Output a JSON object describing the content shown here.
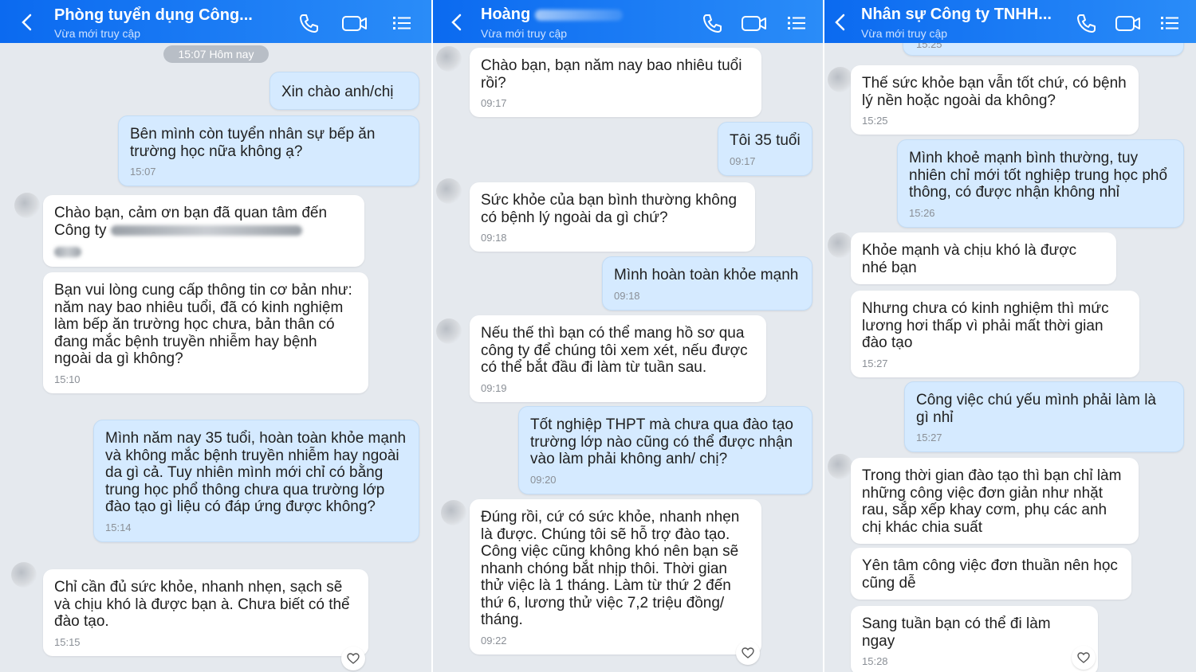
{
  "colors": {
    "header": "#0b6af0",
    "background": "#e5e9ee",
    "incoming": "#ffffff",
    "outgoing": "#d5eaff"
  },
  "panels": [
    {
      "title": "Phòng tuyển dụng Công...",
      "subtitle": "Vừa mới truy cập",
      "date_chip": "15:07 Hôm nay",
      "messages": [
        {
          "dir": "out",
          "text": "Xin chào anh/chị",
          "time": ""
        },
        {
          "dir": "out",
          "text": "Bên mình còn tuyển nhân sự bếp ăn trường học nữa không ạ?",
          "time": "15:07"
        },
        {
          "dir": "in",
          "text": "Chào bạn, cảm ơn bạn đã quan tâm đến Công ty",
          "time": ""
        },
        {
          "dir": "in",
          "text": "Bạn vui lòng cung cấp thông tin cơ bản như: năm nay bao nhiêu tuổi, đã có kinh nghiệm làm bếp ăn trường học chưa, bản thân có đang mắc bệnh truyền nhiễm hay bệnh ngoài da gì không?",
          "time": "15:10"
        },
        {
          "dir": "out",
          "text": "Mình năm nay 35 tuổi, hoàn toàn khỏe mạnh và không mắc bệnh truyền nhiễm hay ngoài da gì cả. Tuy nhiên mình mới chỉ có bằng trung học phổ thông chưa qua trường lớp đào tạo gì liệu có đáp ứng được không?",
          "time": "15:14"
        },
        {
          "dir": "in",
          "text": "Chỉ cần đủ sức khỏe, nhanh nhẹn, sạch sẽ và chịu khó là được bạn à. Chưa biết có thể đào tạo.",
          "time": "15:15"
        }
      ]
    },
    {
      "title": "Hoàng",
      "subtitle": "Vừa mới truy cập",
      "messages": [
        {
          "dir": "in",
          "text": "Chào bạn, bạn năm nay bao nhiêu tuổi rồi?",
          "time": "09:17"
        },
        {
          "dir": "out",
          "text": "Tôi 35 tuổi",
          "time": "09:17"
        },
        {
          "dir": "in",
          "text": "Sức khỏe của bạn bình thường không có bệnh lý ngoài da gì chứ?",
          "time": "09:18"
        },
        {
          "dir": "out",
          "text": "Mình hoàn toàn khỏe mạnh",
          "time": "09:18"
        },
        {
          "dir": "in",
          "text": "Nếu thế thì bạn có thể mang hồ sơ qua công ty để chúng tôi xem xét, nếu được có thể bắt đầu đi làm từ tuần sau.",
          "time": "09:19"
        },
        {
          "dir": "out",
          "text": "Tốt nghiệp THPT mà chưa qua đào tạo trường lớp nào cũng có thể được nhận vào làm phải không anh/ chị?",
          "time": "09:20"
        },
        {
          "dir": "in",
          "text": "Đúng rồi, cứ có sức khỏe, nhanh nhẹn là được. Chúng tôi sẽ hỗ trợ đào tạo. Công việc cũng không khó nên bạn sẽ nhanh chóng bắt nhịp thôi. Thời gian thử việc là 1 tháng. Làm từ thứ 2 đến thứ 6, lương thử việc 7,2 triệu đồng/ tháng.",
          "time": "09:22"
        }
      ]
    },
    {
      "title": "Nhân sự Công ty TNHH...",
      "subtitle": "Vừa mới truy cập",
      "top_partial_time": "15:25",
      "messages": [
        {
          "dir": "in",
          "text": "Thế sức khỏe bạn vẫn tốt chứ, có bệnh lý nền hoặc ngoài da không?",
          "time": "15:25"
        },
        {
          "dir": "out",
          "text": "Mình khoẻ mạnh bình thường, tuy nhiên chỉ mới tốt nghiệp trung học phổ thông, có được nhận không nhỉ",
          "time": "15:26"
        },
        {
          "dir": "in",
          "text": "Khỏe mạnh và chịu khó là được nhé bạn",
          "time": ""
        },
        {
          "dir": "in",
          "text": "Nhưng chưa có kinh nghiệm thì mức lương hơi thấp vì phải mất thời gian đào tạo",
          "time": "15:27"
        },
        {
          "dir": "out",
          "text": "Công việc chú yếu mình phải làm là gì nhỉ",
          "time": "15:27"
        },
        {
          "dir": "in",
          "text": "Trong thời gian đào tạo thì bạn chỉ làm những công việc đơn giản như nhặt rau, sắp xếp khay cơm, phụ các anh chị khác chia suất",
          "time": ""
        },
        {
          "dir": "in",
          "text": "Yên tâm công việc đơn thuần nên học cũng dễ",
          "time": ""
        },
        {
          "dir": "in",
          "text": "Sang tuần bạn có thể đi làm ngay",
          "time": "15:28"
        }
      ]
    }
  ]
}
